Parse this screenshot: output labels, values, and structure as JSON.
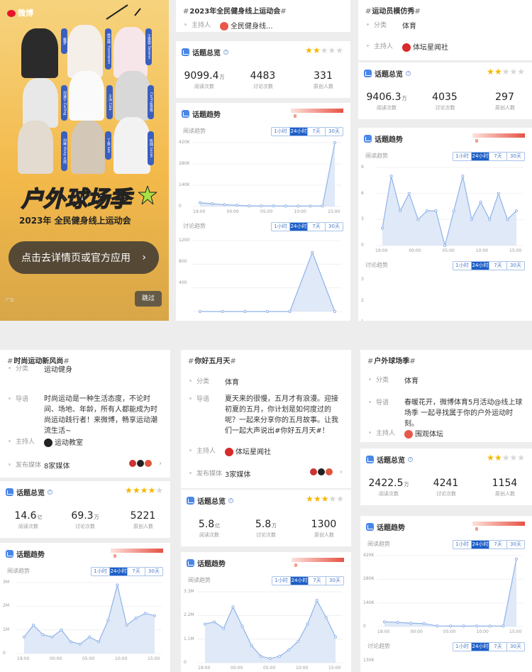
{
  "ad": {
    "logo_text": "微博",
    "celebrities": [
      "戴梦",
      "杨芸晴 Yvonneren",
      "王霏霏 Sevenn",
      "王鹤棣",
      "刘谦宁 Curling",
      "于洋 Cola",
      "Curling首级",
      "丁俊 Leo",
      "陈翔 Lucas",
      "刘琳 Vicky 大伟"
    ],
    "banner_title": "户外球场季",
    "banner_subtitle": "2023年 全民健身线上运动会",
    "cta_label": "点击去详情页或官方应用",
    "cta_chevron": "›",
    "skip_label": "跳过",
    "ad_tag": "广告"
  },
  "cards": [
    {
      "hashtag": "2023年全民健身线上运动会",
      "rows": [
        {
          "key": "主持人",
          "value": "全民健身线...",
          "avatar_color": "#e8584a"
        }
      ],
      "overview_title": "话题总览",
      "stars": {
        "on": 2,
        "off": 3
      },
      "stats": [
        {
          "n": "9099.4",
          "u": "万",
          "l": "阅读次数"
        },
        {
          "n": "4483",
          "u": "",
          "l": "讨论次数"
        },
        {
          "n": "331",
          "u": "",
          "l": "原创人数"
        }
      ],
      "trend_title": "话题趋势",
      "read_label": "阅读趋势",
      "discuss_label": "讨论趋势",
      "tabs": [
        "1小时",
        "24小时",
        "7天",
        "30天"
      ],
      "active_tab": 1,
      "read_y": [
        "420K",
        "280K",
        "140K",
        "0"
      ],
      "read_x": [
        "19:00",
        "00:00",
        "05:00",
        "10:00",
        "15:00"
      ],
      "discuss_y": [
        "1200",
        "800",
        "400"
      ]
    },
    {
      "hashtag": "运动员模仿秀",
      "rows": [
        {
          "key": "分类",
          "value": "体育"
        },
        {
          "key": "主持人",
          "value": "体坛星闻社",
          "avatar_color": "#d9292a"
        }
      ],
      "overview_title": "话题总览",
      "stars": {
        "on": 2,
        "off": 3
      },
      "stats": [
        {
          "n": "9406.3",
          "u": "万",
          "l": "阅读次数"
        },
        {
          "n": "4035",
          "u": "",
          "l": "讨论次数"
        },
        {
          "n": "297",
          "u": "",
          "l": "原创人数"
        }
      ],
      "trend_title": "话题趋势",
      "read_label": "阅读趋势",
      "discuss_label": "讨论趋势",
      "tabs": [
        "1小时",
        "24小时",
        "7天",
        "30天"
      ],
      "active_tab": 1,
      "read_y": [
        "9",
        "6",
        "3",
        "0"
      ],
      "read_x": [
        "19:00",
        "00:00",
        "05:00",
        "10:00",
        "15:00"
      ],
      "discuss_y": [
        "3",
        "2",
        "1"
      ]
    },
    {
      "hashtag": "时尚运动新风尚",
      "rows": [
        {
          "key": "分类",
          "value": "运动健身"
        },
        {
          "key": "导语",
          "value": "时尚运动是一种生活态度，不论时间、场地、年龄，所有人都能成为时尚运动践行者！来微博，畅享运动潮流生活~",
          "multi": true
        },
        {
          "key": "主持人",
          "value": "运动教室",
          "avatar_color": "#222222"
        },
        {
          "key": "发布媒体",
          "value": "8家媒体",
          "media": true
        }
      ],
      "overview_title": "话题总览",
      "stars": {
        "on": 4,
        "off": 1
      },
      "stats": [
        {
          "n": "14.6",
          "u": "亿",
          "l": "阅读次数"
        },
        {
          "n": "69.3",
          "u": "万",
          "l": "讨论次数"
        },
        {
          "n": "5221",
          "u": "",
          "l": "原创人数"
        }
      ],
      "trend_title": "话题趋势",
      "read_label": "阅读趋势",
      "tabs": [
        "1小时",
        "24小时",
        "7天",
        "30天"
      ],
      "active_tab": 1,
      "read_y": [
        "3M",
        "2M",
        "1M",
        "0"
      ],
      "read_x": [
        "19:00",
        "00:00",
        "05:00",
        "10:00",
        "15:00"
      ]
    },
    {
      "hashtag": "你好五月天",
      "rows": [
        {
          "key": "分类",
          "value": "体育"
        },
        {
          "key": "导语",
          "value": "夏天来的很慢，五月才有浪漫。迎接初夏的五月，你计划是如何度过的呢？一起来分享你的五月故事。让我们一起大声说出#你好五月天#！",
          "multi": true
        },
        {
          "key": "主持人",
          "value": "体坛星闻社",
          "avatar_color": "#d9292a"
        },
        {
          "key": "发布媒体",
          "value": "3家媒体",
          "media": true
        }
      ],
      "overview_title": "话题总览",
      "stars": {
        "on": 3,
        "off": 2
      },
      "stats": [
        {
          "n": "5.8",
          "u": "亿",
          "l": "阅读次数"
        },
        {
          "n": "5.8",
          "u": "万",
          "l": "讨论次数"
        },
        {
          "n": "1300",
          "u": "",
          "l": "原创人数"
        }
      ],
      "trend_title": "话题趋势",
      "read_label": "阅读趋势",
      "tabs": [
        "1小时",
        "24小时",
        "7天",
        "30天"
      ],
      "active_tab": 1,
      "read_y": [
        "3.3M",
        "2.2M",
        "1.1M",
        "0"
      ],
      "read_x": [
        "19:00",
        "00:00",
        "05:00",
        "10:00",
        "15:00"
      ]
    },
    {
      "hashtag": "户外球场季",
      "rows": [
        {
          "key": "分类",
          "value": "体育"
        },
        {
          "key": "导语",
          "value": "春暖花开，微博体育5月活动@线上球场季 一起寻找属于你的户外运动时刻。",
          "multi": true
        },
        {
          "key": "主持人",
          "value": "围观体坛",
          "avatar_color": "#e8584a"
        }
      ],
      "overview_title": "话题总览",
      "stars": {
        "on": 2,
        "off": 3
      },
      "stats": [
        {
          "n": "2422.5",
          "u": "万",
          "l": "阅读次数"
        },
        {
          "n": "4241",
          "u": "",
          "l": "讨论次数"
        },
        {
          "n": "1154",
          "u": "",
          "l": "原创人数"
        }
      ],
      "trend_title": "话题趋势",
      "read_label": "阅读趋势",
      "discuss_label": "讨论趋势",
      "tabs": [
        "1小时",
        "24小时",
        "7天",
        "30天"
      ],
      "active_tab": 1,
      "read_y": [
        "420K",
        "280K",
        "140K",
        "0"
      ],
      "read_x": [
        "19:00",
        "00:00",
        "05:00",
        "10:00",
        "15:00"
      ],
      "discuss_y": [
        "130K"
      ]
    }
  ],
  "chart_data": [
    {
      "type": "line",
      "title": "阅读趋势",
      "card": "2023年全民健身线上运动会",
      "x": [
        "19:00",
        "00:00",
        "05:00",
        "10:00",
        "15:00"
      ],
      "ylim": [
        0,
        420000
      ],
      "values": [
        25000,
        18000,
        12000,
        8000,
        4000,
        4000,
        4000,
        3000,
        3000,
        3000,
        4000,
        420000
      ]
    },
    {
      "type": "line",
      "title": "讨论趋势",
      "card": "2023年全民健身线上运动会",
      "ylim": [
        0,
        1200
      ],
      "values": [
        0,
        0,
        0,
        0,
        0,
        1000,
        0
      ]
    },
    {
      "type": "line",
      "title": "阅读趋势",
      "card": "运动员模仿秀",
      "x": [
        "19:00",
        "00:00",
        "05:00",
        "10:00",
        "15:00"
      ],
      "ylim": [
        0,
        9
      ],
      "values": [
        2,
        8,
        4,
        6,
        3,
        4,
        4,
        0,
        4,
        8,
        3,
        5,
        3,
        6,
        3,
        4
      ]
    },
    {
      "type": "line",
      "title": "阅读趋势",
      "card": "时尚运动新风尚",
      "x": [
        "19:00",
        "00:00",
        "05:00",
        "10:00",
        "15:00"
      ],
      "ylim": [
        0,
        3000000
      ],
      "values": [
        700000,
        1200000,
        800000,
        700000,
        1000000,
        500000,
        400000,
        700000,
        500000,
        1400000,
        2900000,
        1200000,
        1500000,
        1700000,
        1600000
      ]
    },
    {
      "type": "line",
      "title": "阅读趋势",
      "card": "你好五月天",
      "x": [
        "19:00",
        "00:00",
        "05:00",
        "10:00",
        "15:00"
      ],
      "ylim": [
        0,
        3300000
      ],
      "values": [
        1800000,
        1900000,
        1600000,
        2600000,
        1700000,
        800000,
        300000,
        200000,
        300000,
        600000,
        1000000,
        1800000,
        2900000,
        2100000,
        1200000
      ]
    },
    {
      "type": "line",
      "title": "阅读趋势",
      "card": "户外球场季",
      "x": [
        "19:00",
        "00:00",
        "05:00",
        "10:00",
        "15:00"
      ],
      "ylim": [
        0,
        420000
      ],
      "values": [
        28000,
        25000,
        20000,
        18000,
        4000,
        3000,
        3000,
        3000,
        3000,
        3000,
        400000
      ]
    }
  ]
}
